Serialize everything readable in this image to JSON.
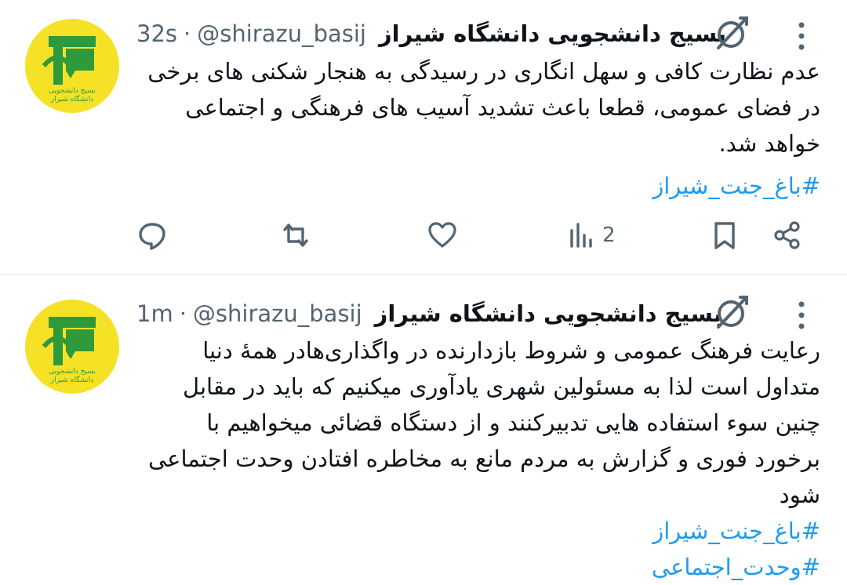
{
  "colors": {
    "accent": "#1d9bf0",
    "secondary_text": "#536471",
    "avatar_bg": "#f5e227",
    "logo_green": "#2f9a3c"
  },
  "tweets": [
    {
      "author_name": "بسیج دانشجویی دانشگاه شیراز",
      "handle": "@shirazu_basij",
      "separator": "·",
      "time": "32s",
      "avatar_lines": [
        "بسیج دانشجویی",
        "دانشگاه شیراز"
      ],
      "text": "عدم نظارت کافی و سهل انگاری در رسیدگی به هنجار شکنی های برخی در فضای عمومی، قطعا باعث تشدید آسیب های فرهنگی و اجتماعی خواهد شد.",
      "hashtags": [
        "#باغ_جنت_شیراز"
      ],
      "views_count": "2",
      "icons": [
        "reply-icon",
        "retweet-icon",
        "like-icon",
        "views-icon",
        "bookmark-icon",
        "share-icon"
      ]
    },
    {
      "author_name": "بسیج دانشجویی دانشگاه شیراز",
      "handle": "@shirazu_basij",
      "separator": "·",
      "time": "1m",
      "avatar_lines": [
        "بسیج دانشجویی",
        "دانشگاه شیراز"
      ],
      "text": "رعایت فرهنگ عمومی و شروط بازدارنده در واگذاری‌هادر همهٔ دنیا متداول است لذا به مسئولین شهری یادآوری میکنیم که باید در مقابل چنین سوء استفاده هایی تدبیرکنند و از دستگاه قضائی میخواهیم با برخورد فوری و گزارش به مردم مانع به مخاطره افتادن وحدت اجتماعی شود",
      "hashtags": [
        "#باغ_جنت_شیراز",
        "#وحدت_اجتماعی"
      ]
    }
  ]
}
